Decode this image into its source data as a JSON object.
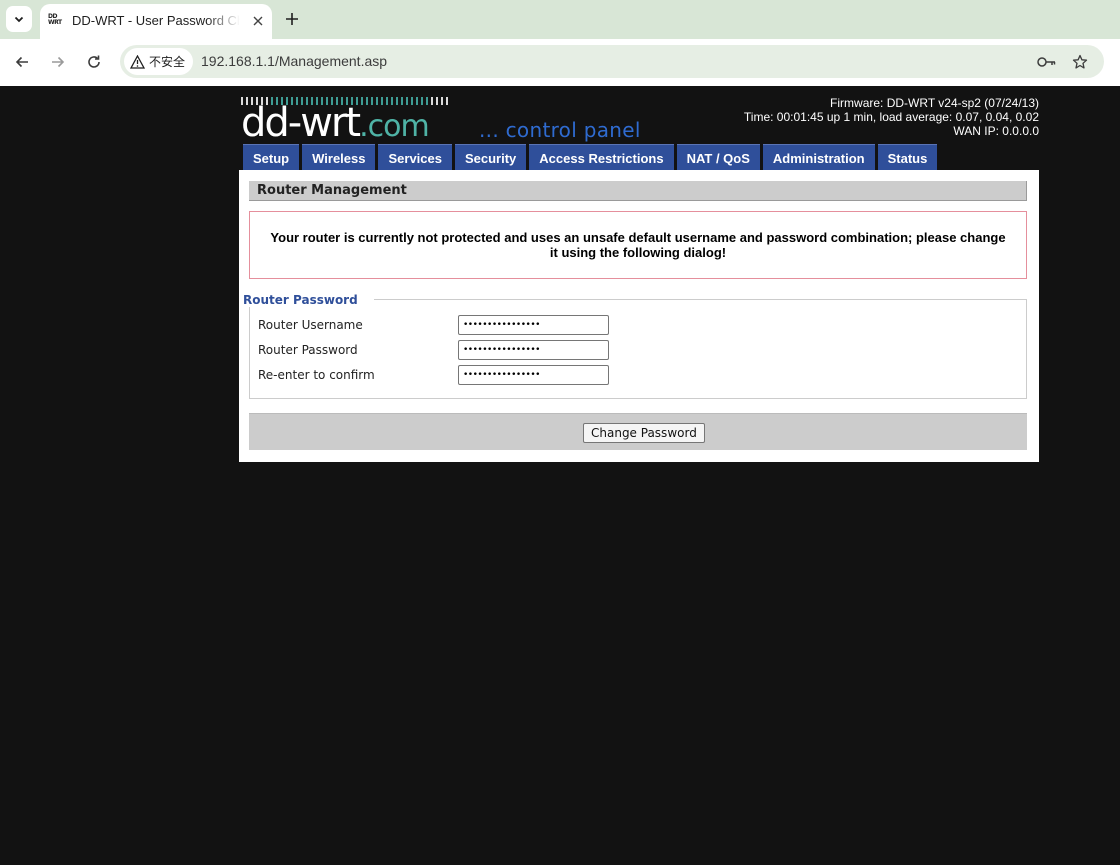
{
  "browser": {
    "tab_title": "DD-WRT - User Password Change",
    "favicon_text": [
      "DD",
      "WRT"
    ],
    "security_label": "不安全",
    "url": "192.168.1.1/Management.asp"
  },
  "logo": {
    "word_main": "dd-wrt",
    "word_suffix": ".com",
    "control_panel": "... control panel"
  },
  "router_info": {
    "firmware": "Firmware: DD-WRT v24-sp2 (07/24/13)",
    "time": "Time: 00:01:45 up 1 min, load average: 0.07, 0.04, 0.02",
    "wan_ip": "WAN IP: 0.0.0.0"
  },
  "menu": [
    "Setup",
    "Wireless",
    "Services",
    "Security",
    "Access Restrictions",
    "NAT / QoS",
    "Administration",
    "Status"
  ],
  "page": {
    "section_title": "Router Management",
    "warning": "Your router is currently not protected and uses an unsafe default username and password combination; please change it using the following dialog!",
    "legend": "Router Password",
    "fields": [
      {
        "label": "Router Username",
        "value": "••••••••••••••••"
      },
      {
        "label": "Router Password",
        "value": "••••••••••••••••"
      },
      {
        "label": "Re-enter to confirm",
        "value": "••••••••••••••••"
      }
    ],
    "button": "Change Password"
  }
}
